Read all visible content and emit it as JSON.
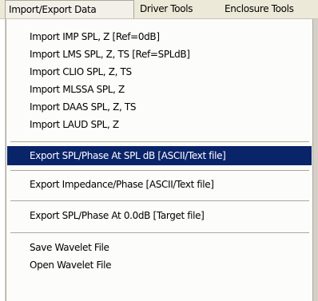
{
  "menubar": {
    "items": [
      {
        "label": "Import/Export Data"
      },
      {
        "label": "Driver Tools"
      },
      {
        "label": "Enclosure Tools"
      }
    ]
  },
  "dropdown": {
    "items": [
      {
        "label": "Import IMP SPL, Z [Ref=0dB]"
      },
      {
        "label": "Import LMS SPL, Z, TS [Ref=SPLdB]"
      },
      {
        "label": "Import CLIO SPL, Z, TS"
      },
      {
        "label": "Import MLSSA SPL, Z"
      },
      {
        "label": "Import DAAS SPL, Z, TS"
      },
      {
        "label": "Import LAUD SPL, Z"
      },
      {
        "label": "Export SPL/Phase At SPL dB [ASCII/Text file]"
      },
      {
        "label": "Export Impedance/Phase [ASCII/Text file]"
      },
      {
        "label": "Export SPL/Phase At 0.0dB [Target file]"
      },
      {
        "label": "Save Wavelet File"
      },
      {
        "label": "Open Wavelet File"
      }
    ]
  }
}
